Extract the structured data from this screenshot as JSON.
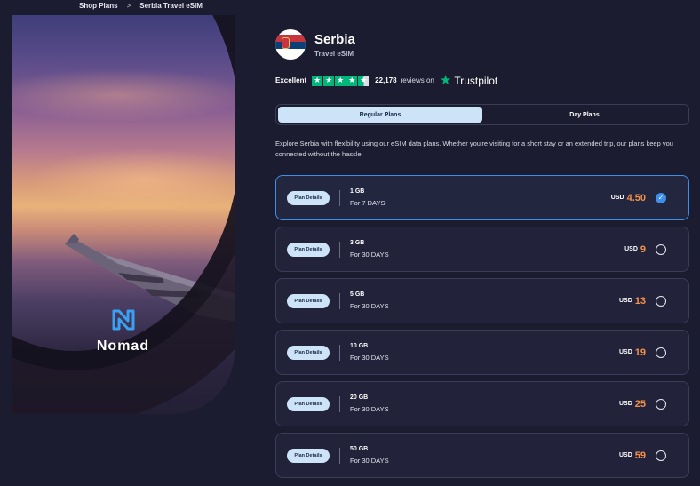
{
  "breadcrumb": {
    "items": [
      "Shop Plans",
      "Serbia Travel eSIM"
    ],
    "separator": ">"
  },
  "hero": {
    "brand": "Nomad",
    "logo_icon": "nomad-logo-icon"
  },
  "country": {
    "name": "Serbia",
    "subtitle": "Travel eSIM",
    "flag_icon": "serbia-flag-icon"
  },
  "rating": {
    "label": "Excellent",
    "stars": 4.5,
    "count": "22,178",
    "on_text": "reviews on",
    "provider": "Trustpilot"
  },
  "tabs": [
    {
      "label": "Regular Plans",
      "active": true
    },
    {
      "label": "Day Plans",
      "active": false
    }
  ],
  "description": "Explore Serbia with flexibility using our eSIM data plans. Whether you're visiting for a short stay or an extended trip, our plans keep you connected without the hassle",
  "plans": [
    {
      "details_label": "Plan Details",
      "data": "1 GB",
      "days": "For 7 DAYS",
      "currency": "USD",
      "price": "4.50",
      "selected": true
    },
    {
      "details_label": "Plan Details",
      "data": "3 GB",
      "days": "For 30 DAYS",
      "currency": "USD",
      "price": "9",
      "selected": false
    },
    {
      "details_label": "Plan Details",
      "data": "5 GB",
      "days": "For 30 DAYS",
      "currency": "USD",
      "price": "13",
      "selected": false
    },
    {
      "details_label": "Plan Details",
      "data": "10 GB",
      "days": "For 30 DAYS",
      "currency": "USD",
      "price": "19",
      "selected": false
    },
    {
      "details_label": "Plan Details",
      "data": "20 GB",
      "days": "For 30 DAYS",
      "currency": "USD",
      "price": "25",
      "selected": false
    },
    {
      "details_label": "Plan Details",
      "data": "50 GB",
      "days": "For 30 DAYS",
      "currency": "USD",
      "price": "59",
      "selected": false
    }
  ],
  "colors": {
    "background": "#1b1c30",
    "accent_blue": "#3d8fea",
    "price_orange": "#f5904a",
    "trustpilot_green": "#00b67a",
    "pill_light_blue": "#cde3f8"
  }
}
